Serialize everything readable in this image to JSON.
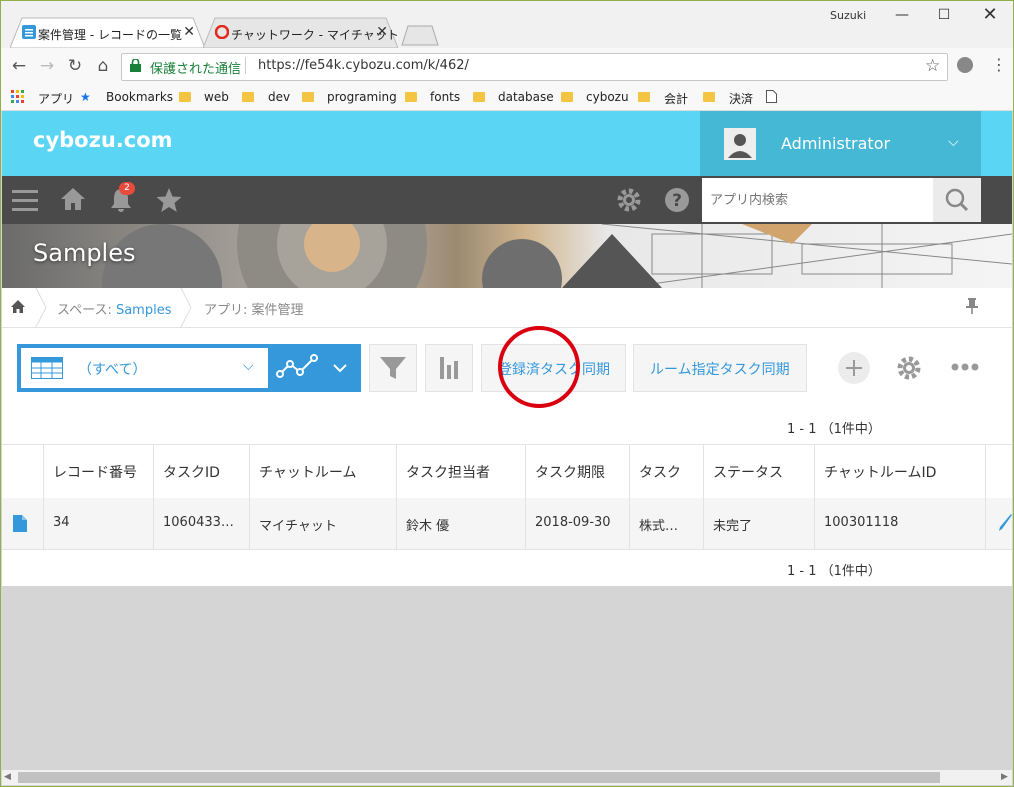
{
  "browser": {
    "tabs": [
      {
        "title": "案件管理 - レコードの一覧",
        "active": true
      },
      {
        "title": "チャットワーク - マイチャット",
        "active": false
      }
    ],
    "user": "Suzuki",
    "secure_label": "保護された通信",
    "url": "https://fe54k.cybozu.com/k/462/",
    "bookmarks": [
      "アプリ",
      "Bookmarks",
      "web",
      "dev",
      "programing",
      "fonts",
      "database",
      "cybozu",
      "会計",
      "決済"
    ]
  },
  "header": {
    "logo": "cybozu.com",
    "user_name": "Administrator",
    "notification_count": "2",
    "search_placeholder": "アプリ内検索"
  },
  "banner": {
    "title": "Samples"
  },
  "breadcrumb": {
    "space_prefix": "スペース: ",
    "space_name": "Samples",
    "app_prefix": "アプリ: ",
    "app_name": "案件管理"
  },
  "toolbar": {
    "view_label": "（すべて）",
    "button1": "登録済タスク同期",
    "button2": "ルーム指定タスク同期"
  },
  "pagination": {
    "top": "1 - 1 （1件中）",
    "bottom": "1 - 1 （1件中）"
  },
  "table": {
    "columns": [
      "レコード番号",
      "タスクID",
      "チャットルーム",
      "タスク担当者",
      "タスク期限",
      "タスク",
      "ステータス",
      "チャットルームID"
    ],
    "rows": [
      [
        "34",
        "1060433…",
        "マイチャット",
        "鈴木 優",
        "2018-09-30",
        "株式…",
        "未完了",
        "100301118"
      ]
    ]
  },
  "colors": {
    "accent": "#3498db",
    "header": "#5ad5f4",
    "dark_nav": "#4a4a4a",
    "highlight_circle": "#d9000f"
  }
}
